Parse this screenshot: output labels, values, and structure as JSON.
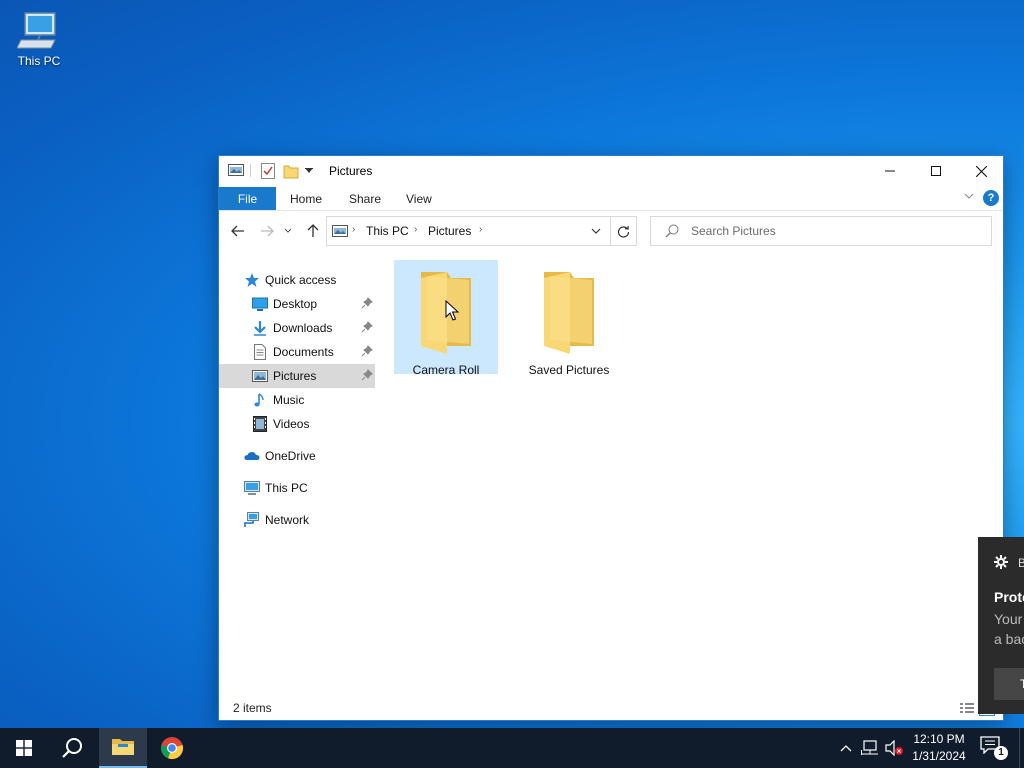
{
  "desktop": {
    "icons": [
      {
        "label": "This PC",
        "icon": "computer-icon"
      }
    ]
  },
  "explorer": {
    "title": "Pictures",
    "ribbon": {
      "file": "File",
      "tabs": [
        "Home",
        "Share",
        "View"
      ],
      "help": "?"
    },
    "address": {
      "segments": [
        "This PC",
        "Pictures"
      ]
    },
    "search": {
      "placeholder": "Search Pictures"
    },
    "nav": {
      "quick_access": "Quick access",
      "pinned": [
        {
          "label": "Desktop",
          "icon": "desktop-icon",
          "pinned": true
        },
        {
          "label": "Downloads",
          "icon": "downloads-icon",
          "pinned": true
        },
        {
          "label": "Documents",
          "icon": "documents-icon",
          "pinned": true
        },
        {
          "label": "Pictures",
          "icon": "pictures-icon",
          "pinned": true,
          "selected": true
        },
        {
          "label": "Music",
          "icon": "music-icon",
          "pinned": false
        },
        {
          "label": "Videos",
          "icon": "videos-icon",
          "pinned": false
        }
      ],
      "onedrive": "OneDrive",
      "this_pc": "This PC",
      "network": "Network"
    },
    "items": [
      {
        "label": "Camera Roll",
        "icon": "folder-icon",
        "selected": true
      },
      {
        "label": "Saved Pictures",
        "icon": "folder-icon",
        "selected": false
      }
    ],
    "status": {
      "count": "2 items"
    }
  },
  "toast": {
    "header": "B",
    "title": "Prote",
    "body_line1": "Your",
    "body_line2": "a bac",
    "button": "T"
  },
  "taskbar": {
    "clock": {
      "time": "12:10 PM",
      "date": "1/31/2024"
    },
    "notification_count": "1",
    "apps": [
      "start-icon",
      "search-icon",
      "file-explorer-icon",
      "chrome-icon"
    ]
  },
  "colors": {
    "accent": "#1979ca",
    "selection": "#cce8ff",
    "taskbar": "#101c2b",
    "folder": "#f8d775"
  }
}
